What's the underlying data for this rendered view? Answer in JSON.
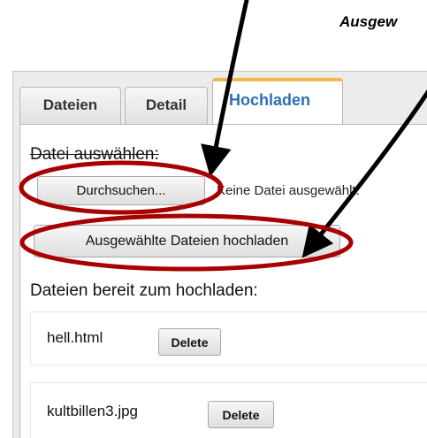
{
  "annotation": {
    "caption": "Ausgew"
  },
  "tabs": [
    {
      "label": "Dateien"
    },
    {
      "label": "Detail"
    },
    {
      "label": "Hochladen"
    }
  ],
  "upload": {
    "select_label": "Datei auswählen:",
    "browse_label": "Durchsuchen...",
    "file_status": "Keine Datei ausgewählt.",
    "upload_selected_label": "Ausgewählte Dateien hochladen",
    "ready_label": "Dateien bereit zum hochladen:"
  },
  "files": [
    {
      "name": "hell.html",
      "delete_label": "Delete"
    },
    {
      "name": "kultbillen3.jpg",
      "delete_label": "Delete"
    }
  ],
  "colors": {
    "annotation": "#a80000",
    "active_tab": "#2f6fb3",
    "active_tab_border": "#f3b84a"
  }
}
